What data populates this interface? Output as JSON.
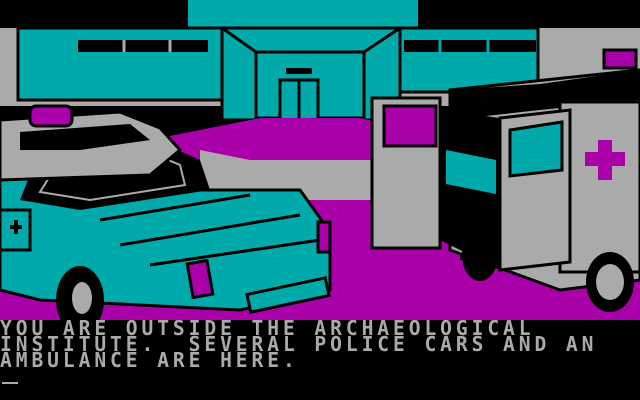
{
  "colors": {
    "black": "#000000",
    "cyan": "#00AAAA",
    "magenta": "#AA00AA",
    "gray": "#AAAAAA"
  },
  "scene": {
    "objects": [
      "archaeological-institute",
      "police-car",
      "police-car-near",
      "ambulance",
      "parking-lot"
    ]
  },
  "narration": {
    "line1": "YOU ARE OUTSIDE THE ARCHAEOLOGICAL",
    "line2": "INSTITUTE.  SEVERAL POLICE CARS AND AN",
    "line3": "AMBULANCE ARE HERE."
  },
  "prompt": {
    "cursor": "_"
  }
}
